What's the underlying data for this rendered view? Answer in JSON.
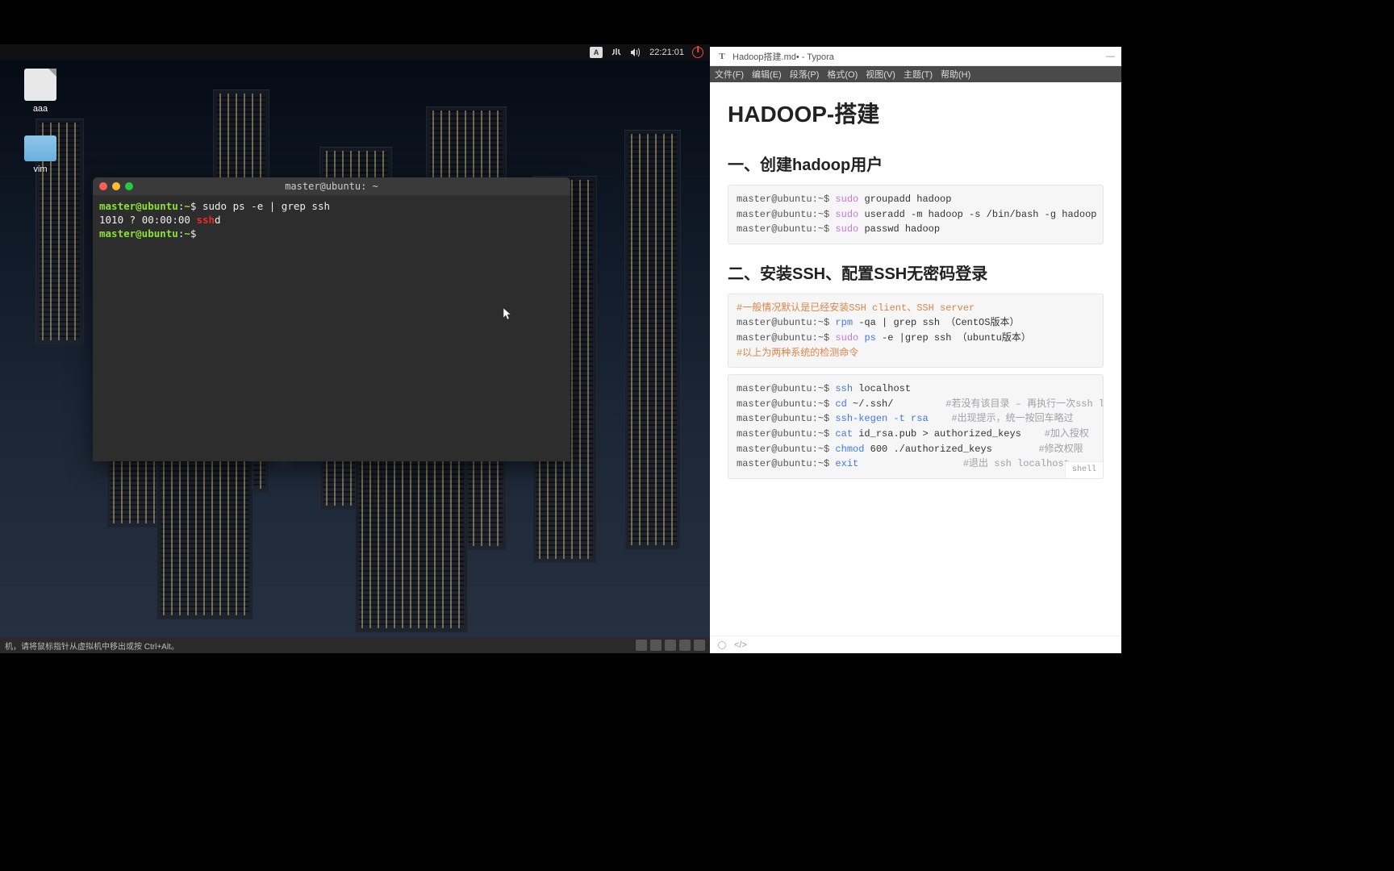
{
  "desktop": {
    "icons": [
      {
        "name": "aaa",
        "type": "file"
      },
      {
        "name": "vim",
        "type": "folder"
      }
    ]
  },
  "topbar": {
    "input_method": "A",
    "time": "22:21:01"
  },
  "terminal": {
    "title": "master@ubuntu: ~",
    "lines": {
      "l1_prompt": "master@ubuntu",
      "l1_sep": ":",
      "l1_path": "~",
      "l1_cmd": "sudo ps -e | grep ssh",
      "l2_pid": "1010 ?",
      "l2_time": "00:00:00",
      "l2_match": "ssh",
      "l2_suffix": "d",
      "l3_prompt": "master@ubuntu",
      "l3_sep": ":",
      "l3_path": "~",
      "l3_dollar": "$"
    }
  },
  "vmbar": {
    "hint": "机，请将鼠标指针从虚拟机中移出或按 Ctrl+Alt。"
  },
  "typora": {
    "title": "Hadoop搭建.md• - Typora",
    "menus": [
      "文件(F)",
      "编辑(E)",
      "段落(P)",
      "格式(O)",
      "视图(V)",
      "主题(T)",
      "帮助(H)"
    ],
    "h1": "HADOOP-搭建",
    "h2_1": "一、创建hadoop用户",
    "h2_2": "二、安装SSH、配置SSH无密码登录",
    "block1": {
      "p1_prompt": "master@ubuntu:~$",
      "p1_sudo": "sudo",
      "p1_rest": "groupadd hadoop",
      "p2_prompt": "master@ubuntu:~$",
      "p2_sudo": "sudo",
      "p2_rest": "useradd -m hadoop -s /bin/bash -g hadoop",
      "p3_prompt": "master@ubuntu:~$",
      "p3_sudo": "sudo",
      "p3_rest": "passwd hadoop"
    },
    "block2": {
      "c1": "#一般情况默认是已经安装SSH client、SSH server",
      "p1_prompt": "master@ubuntu:~$",
      "p1_cmd": "rpm",
      "p1_rest": "-qa | grep ssh （CentOS版本）",
      "p2_prompt": "master@ubuntu:~$",
      "p2_sudo": "sudo",
      "p2_cmd": "ps",
      "p2_rest": "-e |grep ssh （ubuntu版本）",
      "c2": "#以上为两种系统的检测命令"
    },
    "block3": {
      "lang": "shell",
      "p1_prompt": "master@ubuntu:~$",
      "p1_cmd": "ssh",
      "p1_rest": "localhost",
      "p2_prompt": "master@ubuntu:~$",
      "p2_cmd": "cd",
      "p2_rest": "~/.ssh/",
      "p2_comment": "#若没有该目录 – 再执行一次ssh localh",
      "p3_prompt": "master@ubuntu:~$",
      "p3_cmd": "ssh-kegen -t rsa",
      "p3_comment": "#出现提示，统一按回车略过",
      "p4_prompt": "master@ubuntu:~$",
      "p4_cmd": "cat",
      "p4_rest": "id_rsa.pub > authorized_keys",
      "p4_comment": "#加入授权",
      "p5_prompt": "master@ubuntu:~$",
      "p5_cmd": "chmod",
      "p5_rest": "600 ./authorized_keys",
      "p5_comment": "#修改权限",
      "p6_prompt": "master@ubuntu:~$",
      "p6_cmd": "exit",
      "p6_comment": "#退出 ssh localhost"
    }
  }
}
